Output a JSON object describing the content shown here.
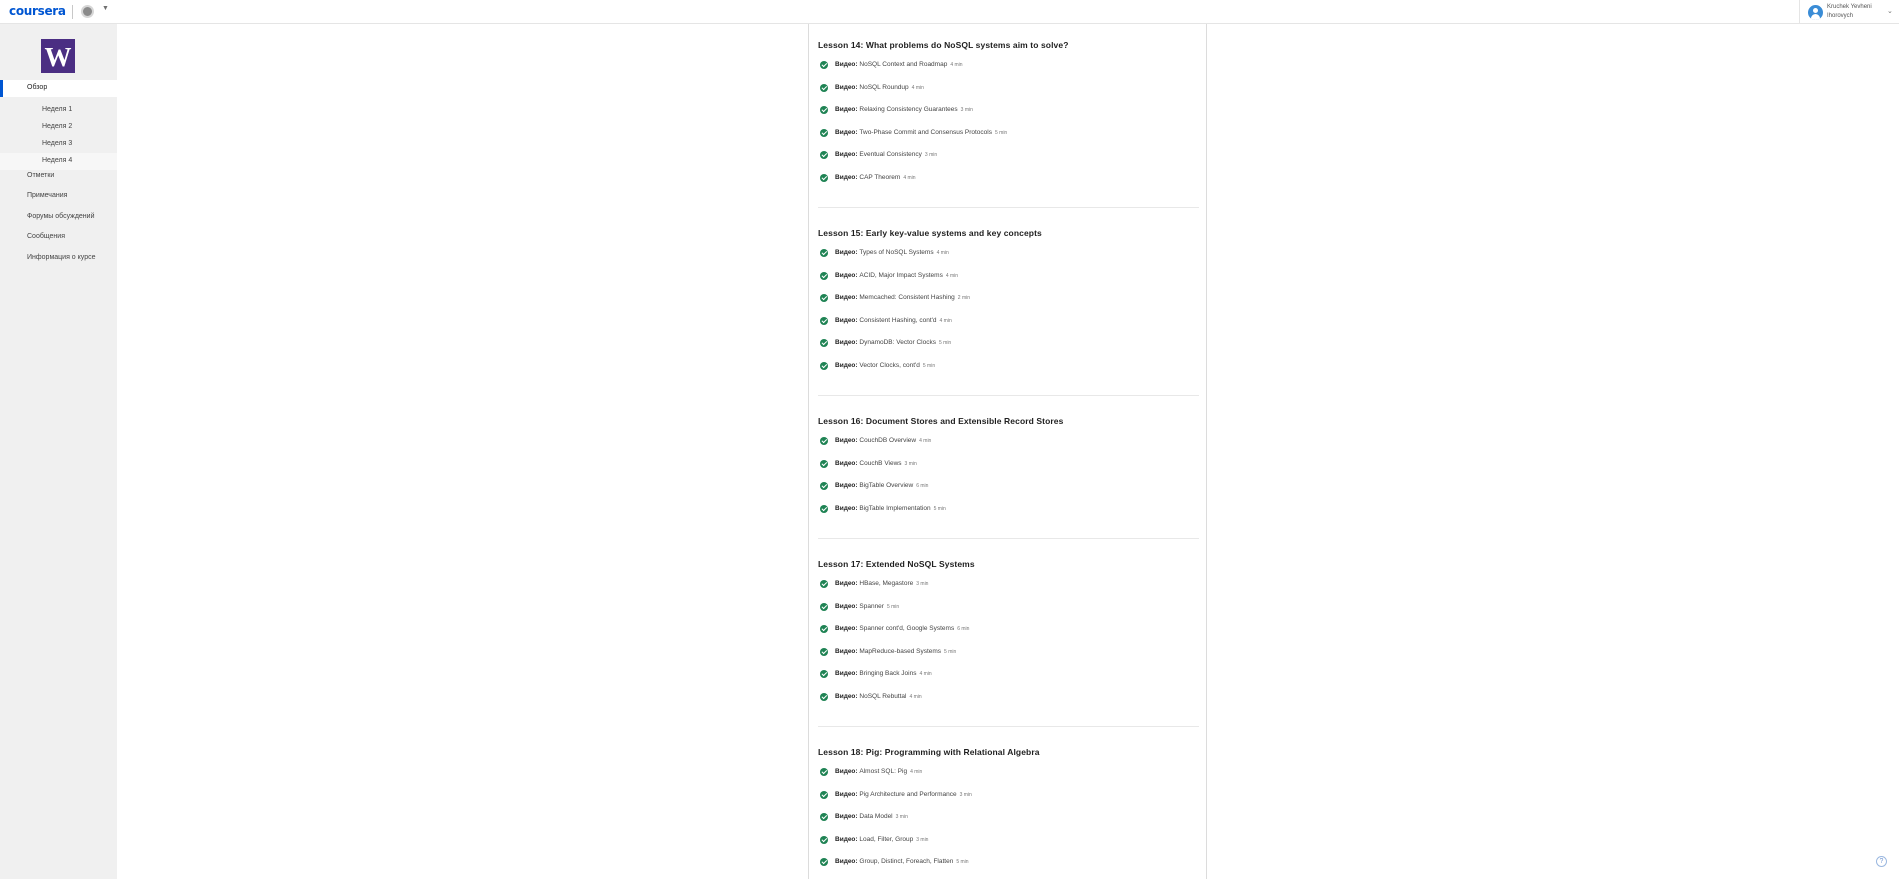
{
  "header": {
    "logo": "coursera",
    "user_name_line1": "Kruchek Yevheni",
    "user_name_line2": "Ihorovych"
  },
  "sidebar": {
    "course_logo_letter": "W",
    "overview": "Обзор",
    "weeks": [
      "Неделя 1",
      "Неделя 2",
      "Неделя 3",
      "Неделя 4"
    ],
    "items": [
      "Отметки",
      "Примечания",
      "Форумы обсуждений",
      "Сообщения",
      "Информация о курсе"
    ]
  },
  "lessons": [
    {
      "title": "Lesson 14: What problems do NoSQL systems aim to solve?",
      "items": [
        {
          "kind": "Видео:",
          "name": "NoSQL Context and Roadmap",
          "duration": "4 min"
        },
        {
          "kind": "Видео:",
          "name": "NoSQL Roundup",
          "duration": "4 min"
        },
        {
          "kind": "Видео:",
          "name": "Relaxing Consistency Guarantees",
          "duration": "3 min"
        },
        {
          "kind": "Видео:",
          "name": "Two-Phase Commit and Consensus Protocols",
          "duration": "5 min"
        },
        {
          "kind": "Видео:",
          "name": "Eventual Consistency",
          "duration": "3 min"
        },
        {
          "kind": "Видео:",
          "name": "CAP Theorem",
          "duration": "4 min"
        }
      ]
    },
    {
      "title": "Lesson 15: Early key-value systems and key concepts",
      "items": [
        {
          "kind": "Видео:",
          "name": "Types of NoSQL Systems",
          "duration": "4 min"
        },
        {
          "kind": "Видео:",
          "name": "ACID, Major Impact Systems",
          "duration": "4 min"
        },
        {
          "kind": "Видео:",
          "name": "Memcached: Consistent Hashing",
          "duration": "2 min"
        },
        {
          "kind": "Видео:",
          "name": "Consistent Hashing, cont'd",
          "duration": "4 min"
        },
        {
          "kind": "Видео:",
          "name": "DynamoDB: Vector Clocks",
          "duration": "5 min"
        },
        {
          "kind": "Видео:",
          "name": "Vector Clocks, cont'd",
          "duration": "5 min"
        }
      ]
    },
    {
      "title": "Lesson 16: Document Stores and Extensible Record Stores",
      "items": [
        {
          "kind": "Видео:",
          "name": "CouchDB Overview",
          "duration": "4 min"
        },
        {
          "kind": "Видео:",
          "name": "CouchB Views",
          "duration": "3 min"
        },
        {
          "kind": "Видео:",
          "name": "BigTable Overview",
          "duration": "6 min"
        },
        {
          "kind": "Видео:",
          "name": "BigTable Implementation",
          "duration": "5 min"
        }
      ]
    },
    {
      "title": "Lesson 17: Extended NoSQL Systems",
      "items": [
        {
          "kind": "Видео:",
          "name": "HBase, Megastore",
          "duration": "3 min"
        },
        {
          "kind": "Видео:",
          "name": "Spanner",
          "duration": "5 min"
        },
        {
          "kind": "Видео:",
          "name": "Spanner cont'd, Google Systems",
          "duration": "6 min"
        },
        {
          "kind": "Видео:",
          "name": "MapReduce-based Systems",
          "duration": "5 min"
        },
        {
          "kind": "Видео:",
          "name": "Bringing Back Joins",
          "duration": "4 min"
        },
        {
          "kind": "Видео:",
          "name": "NoSQL Rebuttal",
          "duration": "4 min"
        }
      ]
    },
    {
      "title": "Lesson 18: Pig: Programming with Relational Algebra",
      "items": [
        {
          "kind": "Видео:",
          "name": "Almost SQL: Pig",
          "duration": "4 min"
        },
        {
          "kind": "Видео:",
          "name": "Pig Architecture and Performance",
          "duration": "3 min"
        },
        {
          "kind": "Видео:",
          "name": "Data Model",
          "duration": "3 min"
        },
        {
          "kind": "Видео:",
          "name": "Load, Filter, Group",
          "duration": "3 min"
        },
        {
          "kind": "Видео:",
          "name": "Group, Distinct, Foreach, Flatten",
          "duration": "5 min"
        }
      ]
    }
  ]
}
